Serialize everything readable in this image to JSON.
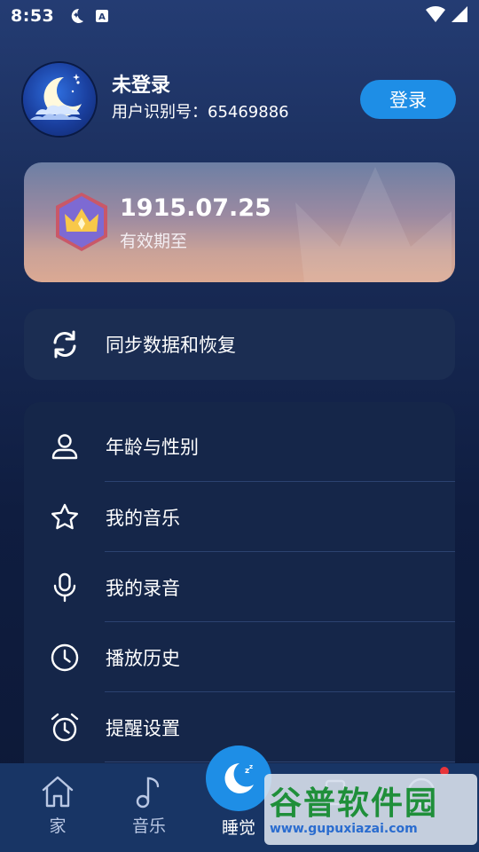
{
  "status_bar": {
    "time": "8:53"
  },
  "profile": {
    "name": "未登录",
    "user_id": "用户识别号：65469886",
    "login_label": "登录"
  },
  "vip": {
    "expiry_date": "1915.07.25",
    "expiry_label": "有效期至"
  },
  "sync": {
    "label": "同步数据和恢复"
  },
  "menu": {
    "items": [
      {
        "label": "年龄与性别",
        "icon": "person-icon"
      },
      {
        "label": "我的音乐",
        "icon": "star-icon"
      },
      {
        "label": "我的录音",
        "icon": "microphone-icon"
      },
      {
        "label": "播放历史",
        "icon": "clock-icon"
      },
      {
        "label": "提醒设置",
        "icon": "alarm-icon"
      }
    ]
  },
  "tabbar": {
    "tabs": [
      {
        "label": "家",
        "icon": "home-icon"
      },
      {
        "label": "音乐",
        "icon": "music-note-icon"
      },
      {
        "label": "睡觉",
        "icon": "moon-sleep-icon",
        "active": true
      },
      {
        "label": "",
        "icon": ""
      },
      {
        "label": "",
        "icon": ""
      }
    ]
  },
  "watermark": {
    "main": "谷普软件园",
    "url": "www.gupuxiazai.com"
  },
  "colors": {
    "accent": "#1e8ee6",
    "badge_dot": "#e8353a"
  }
}
